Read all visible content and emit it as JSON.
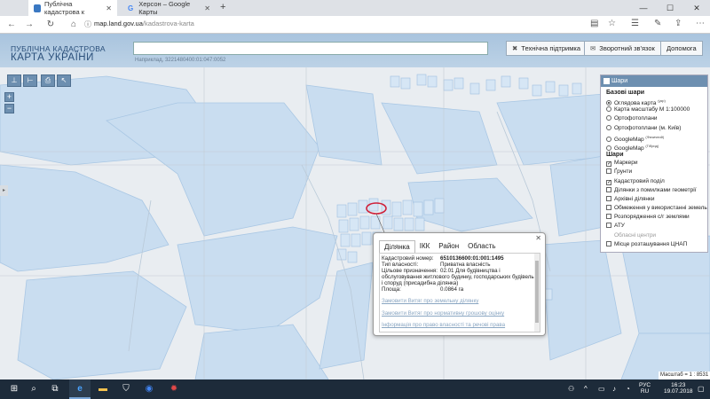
{
  "browser": {
    "tabs": [
      {
        "title": "Публічна кадастрова к",
        "active": true
      },
      {
        "title": "Херсон – Google Карты",
        "active": false
      }
    ],
    "new_tab": "+",
    "url_host": "map.land.gov.ua",
    "url_path": "/kadastrova-karta"
  },
  "header": {
    "logo_line1": "ПУБЛІЧНА КАДАСТРОВА",
    "logo_line2": "КАРТА УКРАЇНИ",
    "search_placeholder": "",
    "search_hint": "Наприклад, 3221480400:01:047:0052",
    "buttons": {
      "support": "Технічна підтримка",
      "feedback": "Зворотний зв'язок",
      "help": "Допомога"
    }
  },
  "map": {
    "zoom_in": "+",
    "zoom_out": "−",
    "scale_label": "Масштаб = 1 : 8531"
  },
  "layers": {
    "title": "Шари",
    "base_title": "Базові шари",
    "base": [
      {
        "label": "Оглядова карта",
        "sup": "(укр)",
        "selected": true
      },
      {
        "label": "Карта масштабу М 1:100000",
        "sup": "",
        "selected": false
      },
      {
        "label": "Ортофотоплани",
        "sup": "",
        "selected": false
      },
      {
        "label": "Ортофотоплани (м. Київ)",
        "sup": "",
        "selected": false
      },
      {
        "label": "GoogleMap",
        "sup": "(Физичний)",
        "selected": false
      },
      {
        "label": "GoogleMap",
        "sup": "(Гібрид)",
        "selected": false
      }
    ],
    "overlay_title": "Шари",
    "overlays": [
      {
        "label": "Маркери",
        "checked": true,
        "dim": false
      },
      {
        "label": "Ґрунти",
        "checked": false,
        "dim": false
      },
      {
        "label": "Кадастровий поділ",
        "checked": true,
        "dim": false
      },
      {
        "label": "Ділянки з помилками геометрії",
        "checked": false,
        "dim": false
      },
      {
        "label": "Архівні ділянки",
        "checked": false,
        "dim": false
      },
      {
        "label": "Обмеження у використанні земель",
        "checked": false,
        "dim": false
      },
      {
        "label": "Розпорядження с/г землями",
        "checked": false,
        "dim": false
      },
      {
        "label": "АТУ",
        "checked": false,
        "dim": false
      },
      {
        "label": "Обласні центри",
        "checked": false,
        "dim": true
      },
      {
        "label": "Місце розташування ЦНАП",
        "checked": false,
        "dim": false
      }
    ]
  },
  "popup": {
    "tabs": [
      "Ділянка",
      "ІКК",
      "Район",
      "Область"
    ],
    "fields": {
      "cadnum_label": "Кадастровий номер:",
      "cadnum_value": "6510136600:01:001:1495",
      "ownership_label": "Тип власності:",
      "ownership_value": "Приватна власність",
      "purpose_label": "Цільове призначення:",
      "purpose_value_1": "02.01 Для будівництва і",
      "purpose_value_2": "обслуговування житлового будинку, господарських будівель",
      "purpose_value_3": "і споруд (присадибна ділянка)",
      "area_label": "Площа:",
      "area_value": "0.0864 га"
    },
    "links": [
      "Замовити Витяг про земельну ділянку",
      "Замовити Витяг про нормативну грошову оцінку",
      "Інформація про право власності та речові права"
    ]
  },
  "taskbar": {
    "lang1": "РУС",
    "lang2": "RU",
    "time": "16:23",
    "date": "19.07.2018"
  }
}
